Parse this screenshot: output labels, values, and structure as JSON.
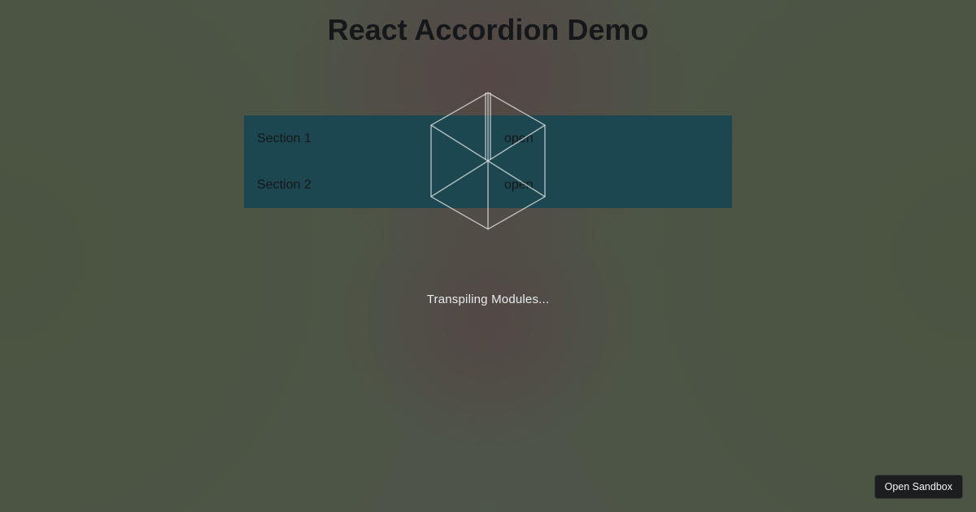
{
  "page": {
    "title": "React Accordion Demo"
  },
  "accordion": {
    "sections": [
      {
        "title": "Section 1",
        "action": "open"
      },
      {
        "title": "Section 2",
        "action": "open"
      }
    ]
  },
  "loader": {
    "status_text": "Transpiling Modules..."
  },
  "footer": {
    "open_sandbox_label": "Open Sandbox"
  }
}
